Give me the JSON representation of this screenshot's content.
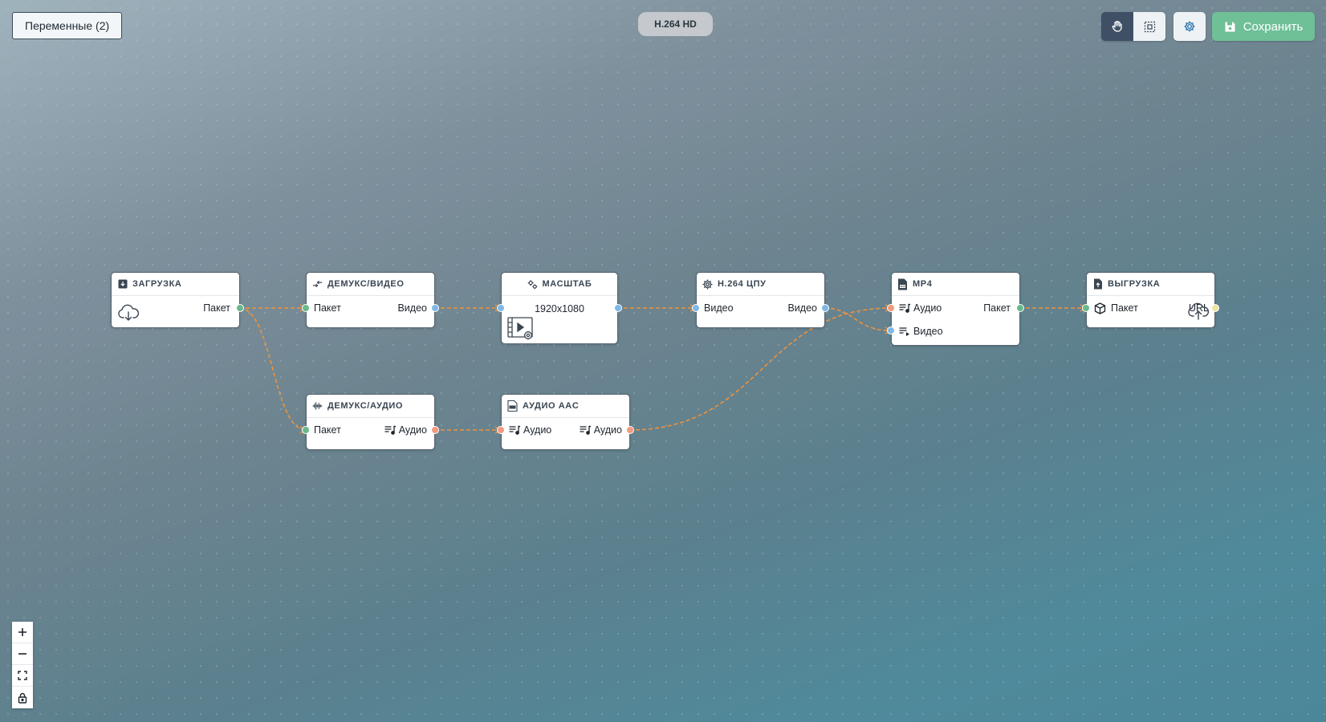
{
  "toolbar": {
    "variables_label": "Переменные (2)",
    "pipeline_title": "H.264 HD",
    "save_label": "Сохранить"
  },
  "colors": {
    "edge": "#f0923a",
    "port_packet": "#6ab88a",
    "port_video": "#7fb8e6",
    "port_audio": "#f39a7c",
    "port_url": "#efe4a4",
    "save_button": "#6fbf97",
    "active_tool": "#3f5066"
  },
  "nodes": {
    "upload": {
      "title": "ЗАГРУЗКА",
      "out": "Пакет",
      "icon": "download-cloud-icon"
    },
    "demux_video": {
      "title": "ДЕМУКС/ВИДЕО",
      "in": "Пакет",
      "out": "Видео"
    },
    "scale": {
      "title": "МАСШТАБ",
      "resolution": "1920x1080"
    },
    "h264": {
      "title": "H.264 ЦПУ",
      "in": "Видео",
      "out": "Видео"
    },
    "mp4": {
      "title": "MP4",
      "in_audio": "Аудио",
      "in_video": "Видео",
      "out": "Пакет"
    },
    "export": {
      "title": "ВЫГРУЗКА",
      "in": "Пакет",
      "out": "URL",
      "icon": "upload-cloud-icon"
    },
    "demux_audio": {
      "title": "ДЕМУКС/АУДИО",
      "in": "Пакет",
      "out": "Аудио"
    },
    "aac": {
      "title": "АУДИО AAC",
      "in": "Аудио",
      "out": "Аудио"
    }
  },
  "zoom": {
    "zoom_in": "+",
    "zoom_out": "−"
  }
}
